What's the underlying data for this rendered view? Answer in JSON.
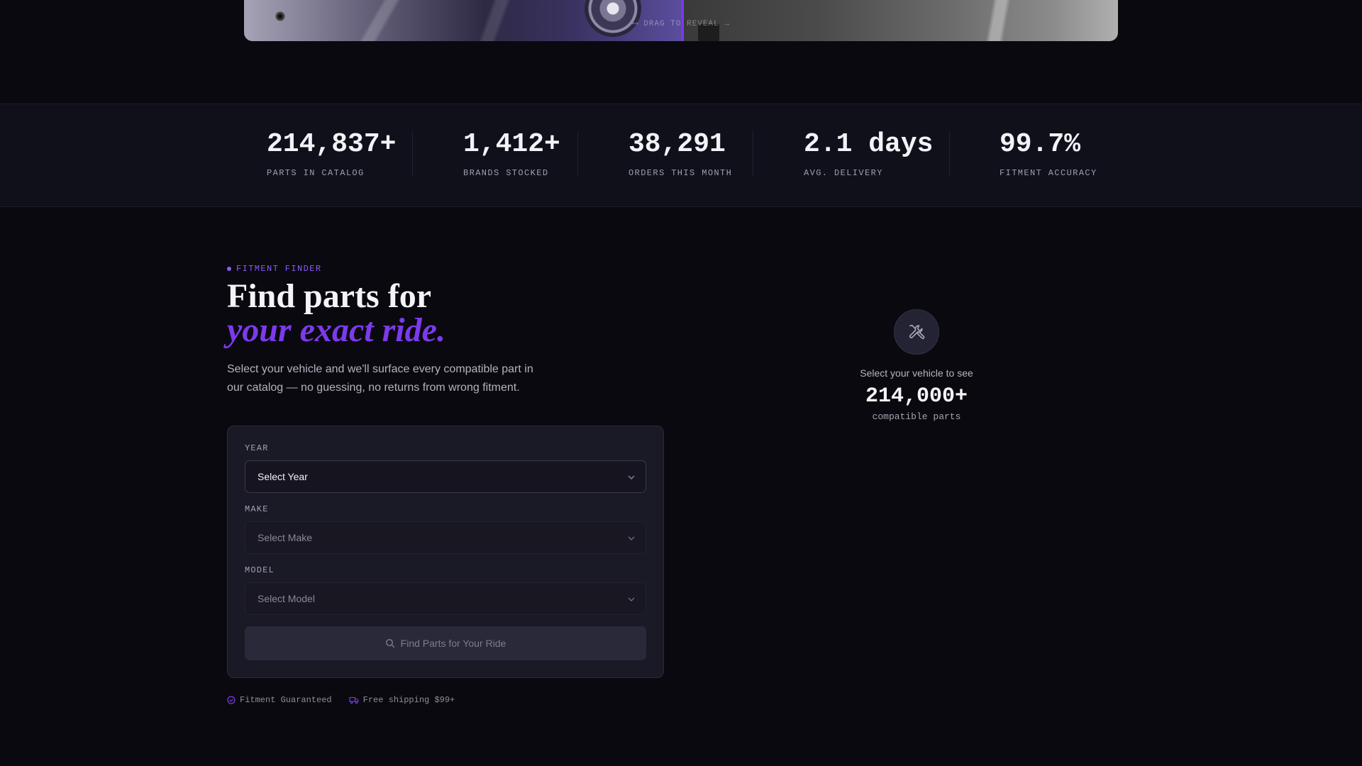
{
  "hero": {
    "drag_hint": "⟷ DRAG TO REVEAL →",
    "divider_color": "#7c3aed"
  },
  "stats": [
    {
      "value": "214,837+",
      "label": "PARTS IN CATALOG"
    },
    {
      "value": "1,412+",
      "label": "BRANDS STOCKED"
    },
    {
      "value": "38,291",
      "label": "ORDERS THIS MONTH"
    },
    {
      "value": "2.1 days",
      "label": "AVG. DELIVERY"
    },
    {
      "value": "99.7%",
      "label": "FITMENT ACCURACY"
    }
  ],
  "finder": {
    "eyebrow": "FITMENT FINDER",
    "headline_line1": "Find parts for",
    "headline_line2": "your exact ride.",
    "subcopy": "Select your vehicle and we'll surface every compatible part in our catalog — no guessing, no returns from wrong fitment.",
    "accent_color": "#7c3aed",
    "fields": {
      "year": {
        "label": "YEAR",
        "value": "Select Year",
        "state": "active"
      },
      "make": {
        "label": "MAKE",
        "value": "Select Make",
        "state": "disabled"
      },
      "model": {
        "label": "MODEL",
        "value": "Select Model",
        "state": "disabled"
      }
    },
    "submit_label": "Find Parts for Your Ride",
    "guarantees": [
      {
        "icon": "check-circle-icon",
        "text": "Fitment Guaranteed"
      },
      {
        "icon": "truck-icon",
        "text": "Free shipping $99+"
      }
    ]
  },
  "preview": {
    "icon": "wrench-screwdriver-icon",
    "caption": "Select your vehicle to see",
    "count": "214,000+",
    "unit": "compatible parts"
  }
}
